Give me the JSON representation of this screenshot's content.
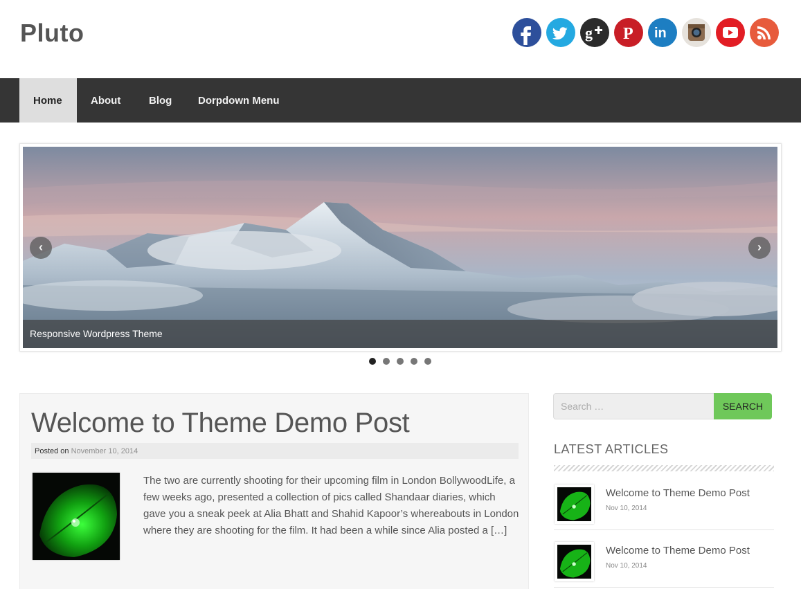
{
  "site": {
    "title": "Pluto"
  },
  "social": [
    {
      "name": "facebook-icon",
      "glyph": "f",
      "color": "#2d4f9b"
    },
    {
      "name": "twitter-icon",
      "glyph": "t",
      "color": "#24a9e1"
    },
    {
      "name": "google-plus-icon",
      "glyph": "g+",
      "color": "#2b2b2b"
    },
    {
      "name": "pinterest-icon",
      "glyph": "P",
      "color": "#c81e26"
    },
    {
      "name": "linkedin-icon",
      "glyph": "in",
      "color": "#1d7ec2"
    },
    {
      "name": "instagram-icon",
      "glyph": "◎",
      "color": "#8b6b4f"
    },
    {
      "name": "youtube-icon",
      "glyph": "▶",
      "color": "#e21d24"
    },
    {
      "name": "rss-icon",
      "glyph": "◠",
      "color": "#e75b3c"
    }
  ],
  "nav": {
    "items": [
      {
        "label": "Home",
        "active": true
      },
      {
        "label": "About",
        "active": false
      },
      {
        "label": "Blog",
        "active": false
      },
      {
        "label": "Dorpdown Menu",
        "active": false
      }
    ]
  },
  "slider": {
    "caption": "Responsive Wordpress Theme",
    "prev_glyph": "‹",
    "next_glyph": "›",
    "total_slides": 5,
    "active_slide": 1
  },
  "post": {
    "title": "Welcome to Theme Demo Post",
    "meta_prefix": "Posted on",
    "date": "November 10, 2014",
    "excerpt": "The two are currently shooting for their upcoming film in London BollywoodLife, a few weeks ago, presented a collection of pics called Shandaar diaries, which gave you a sneak peek at Alia Bhatt and Shahid Kapoor’s whereabouts in London where they are shooting for the film. It had been a while since Alia posted a",
    "more": "[…]"
  },
  "sidebar": {
    "search_placeholder": "Search …",
    "search_button": "SEARCH",
    "widget_title": "LATEST ARTICLES",
    "articles": [
      {
        "title": "Welcome to Theme Demo Post",
        "date": "Nov 10, 2014"
      },
      {
        "title": "Welcome to Theme Demo Post",
        "date": "Nov 10, 2014"
      }
    ]
  },
  "colors": {
    "nav_bg": "#353535",
    "nav_active_bg": "#dedede",
    "search_button": "#6fc85a",
    "post_bg": "#f6f6f6"
  }
}
